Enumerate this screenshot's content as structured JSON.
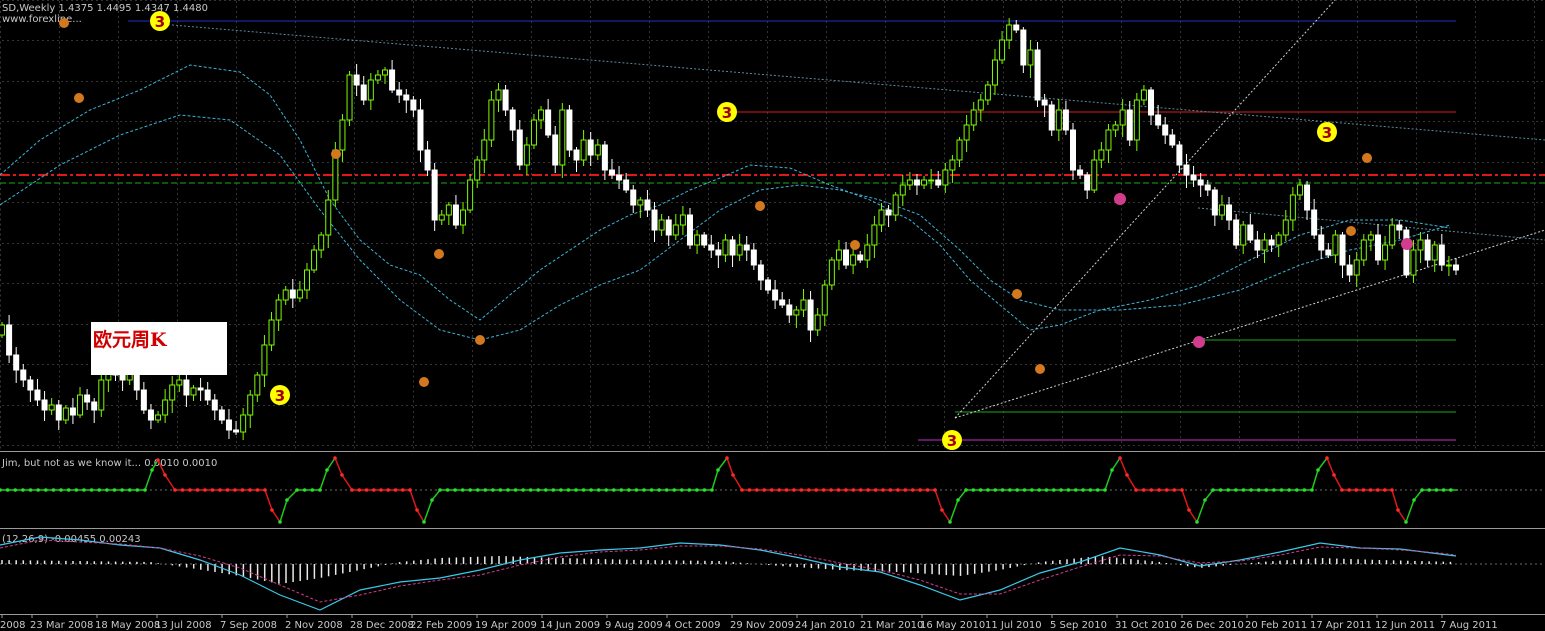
{
  "header": {
    "symbol_line": "SD,Weekly  1.4375 1.4495 1.4347 1.4480",
    "source": "www.forexline..."
  },
  "annotation_box": {
    "text": "欧元周K"
  },
  "indicator1": {
    "label": "Jim, but not as we know it... 0.0010 0.0010"
  },
  "indicator2": {
    "label": "(12,26,9) -0.00455 0.00243"
  },
  "markers": [
    {
      "id": "top-2008",
      "text": "3"
    },
    {
      "id": "bottom-2008",
      "text": "3"
    },
    {
      "id": "top-2009",
      "text": "3"
    },
    {
      "id": "bottom-2010",
      "text": "3"
    },
    {
      "id": "top-2011",
      "text": "3"
    }
  ],
  "xaxis": {
    "ticks": [
      "2008",
      "23 Mar 2008",
      "18 May 2008",
      "13 Jul 2008",
      "7 Sep 2008",
      "2 Nov 2008",
      "28 Dec 2008",
      "22 Feb 2009",
      "19 Apr 2009",
      "14 Jun 2009",
      "9 Aug 2009",
      "4 Oct 2009",
      "29 Nov 2009",
      "24 Jan 2010",
      "21 Mar 2010",
      "16 May 2010",
      "11 Jul 2010",
      "5 Sep 2010",
      "31 Oct 2010",
      "26 Dec 2010",
      "20 Feb 2011",
      "17 Apr 2011",
      "12 Jun 2011",
      "7 Aug 2011"
    ]
  },
  "colors": {
    "background": "#000000",
    "grid": "#6a6a6a",
    "bull_candle": "#7cfc00",
    "bear_candle": "#ffffff",
    "ma": "#3cb4d8",
    "marker": "#ffff00",
    "fractal_orange": "#d2781e",
    "fractal_pink": "#d23c8c"
  },
  "chart_data": {
    "type": "candlestick",
    "levels": [
      "blue",
      "red",
      "red-dashed",
      "green-dashed",
      "green",
      "green",
      "magenta"
    ],
    "closes": [
      125,
      95,
      80,
      70,
      60,
      50,
      40,
      45,
      30,
      42,
      35,
      55,
      48,
      40,
      70,
      95,
      75,
      70,
      85,
      60,
      40,
      30,
      35,
      50,
      65,
      70,
      55,
      62,
      60,
      50,
      40,
      30,
      20,
      18,
      35,
      55,
      75,
      105,
      130,
      150,
      160,
      152,
      160,
      180,
      200,
      215,
      250,
      300,
      330,
      375,
      365,
      350,
      370,
      375,
      380,
      360,
      355,
      350,
      340,
      300,
      280,
      230,
      235,
      245,
      225,
      240,
      270,
      290,
      310,
      350,
      360,
      340,
      320,
      285,
      305,
      330,
      340,
      315,
      285,
      340,
      300,
      290,
      310,
      295,
      305,
      280,
      275,
      270,
      260,
      245,
      250,
      240,
      220,
      230,
      215,
      225,
      235,
      205,
      215,
      205,
      200,
      195,
      210,
      195,
      205,
      200,
      185,
      170,
      160,
      150,
      145,
      135,
      140,
      150,
      120,
      135,
      165,
      190,
      200,
      185,
      195,
      190,
      205,
      225,
      240,
      235,
      255,
      265,
      270,
      265,
      270,
      270,
      265,
      280,
      290,
      310,
      325,
      340,
      350,
      365,
      390,
      410,
      425,
      420,
      385,
      400,
      350,
      345,
      320,
      340,
      320,
      280,
      275,
      260,
      290,
      300,
      320,
      325,
      340,
      310,
      350,
      360,
      335,
      325,
      315,
      305,
      285,
      275,
      270,
      265,
      260,
      235,
      245,
      230,
      205,
      225,
      210,
      200,
      210,
      205,
      215,
      230,
      255,
      265,
      240,
      215,
      200,
      195,
      215,
      185,
      175,
      190,
      210,
      215,
      190,
      205,
      225,
      220,
      175,
      200,
      210,
      190,
      205,
      185,
      185,
      180
    ],
    "panel2_series": "step indicator (green/red)",
    "panel3_series": "MACD histogram + signal"
  }
}
